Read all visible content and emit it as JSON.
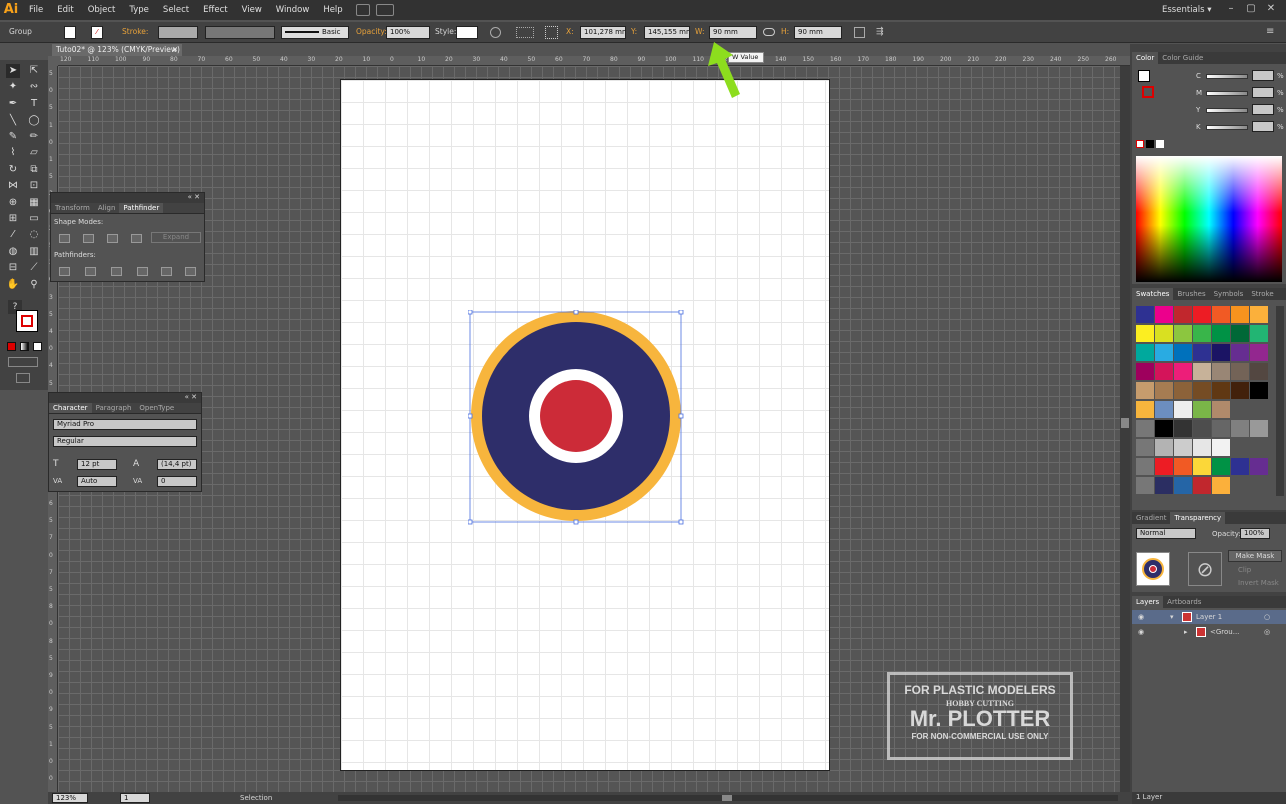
{
  "app": {
    "logo": "Ai",
    "menus": [
      "File",
      "Edit",
      "Object",
      "Type",
      "Select",
      "Effect",
      "View",
      "Window",
      "Help"
    ],
    "workspace": "Essentials ▾",
    "window_controls": [
      "–",
      "▢",
      "✕"
    ]
  },
  "control": {
    "selection": "Group",
    "stroke_label": "Stroke:",
    "brush_label": "Basic",
    "opacity_label": "Opacity:",
    "opacity": "100%",
    "style_label": "Style:",
    "x_label": "X:",
    "x": "101,278 mm",
    "y_label": "Y:",
    "y": "145,155 mm",
    "w_label": "W:",
    "w": "90 mm",
    "h_label": "H:",
    "h": "90 mm"
  },
  "tooltip": "W Value",
  "document": {
    "tab": "Tuto02* @ 123% (CMYK/Preview)",
    "close": "✕"
  },
  "ruler_h": [
    "120",
    "110",
    "100",
    "90",
    "80",
    "70",
    "60",
    "50",
    "40",
    "30",
    "20",
    "10",
    "0",
    "10",
    "20",
    "30",
    "40",
    "50",
    "60",
    "70",
    "80",
    "90",
    "100",
    "110",
    "120",
    "130",
    "140",
    "150",
    "160",
    "170",
    "180",
    "190",
    "200",
    "210",
    "220",
    "230",
    "240",
    "250",
    "260",
    "270",
    "280",
    "290",
    "300",
    "310",
    "320",
    "330",
    "340"
  ],
  "ruler_v": [
    "5",
    "0",
    "5",
    "1",
    "0",
    "1",
    "5",
    "2",
    "0",
    "2",
    "5",
    "3",
    "0",
    "3",
    "5",
    "4",
    "0",
    "4",
    "5",
    "5",
    "0",
    "5",
    "5",
    "6",
    "0",
    "6",
    "5",
    "7",
    "0",
    "7",
    "5",
    "8",
    "0",
    "8",
    "5",
    "9",
    "0",
    "9",
    "5",
    "1",
    "0",
    "0"
  ],
  "pathfinder": {
    "tabs": [
      "Transform",
      "Align",
      "Pathfinder"
    ],
    "shape_modes": "Shape Modes:",
    "expand": "Expand",
    "pathfinders": "Pathfinders:"
  },
  "character": {
    "tabs": [
      "Character",
      "Paragraph",
      "OpenType"
    ],
    "font": "Myriad Pro",
    "style": "Regular",
    "size": "12 pt",
    "leading": "(14,4 pt)",
    "kerning": "Auto",
    "tracking": "0"
  },
  "color_panel": {
    "tabs": [
      "Color",
      "Color Guide"
    ],
    "channels": [
      "C",
      "M",
      "Y",
      "K"
    ],
    "pct": "%"
  },
  "swatches": {
    "tabs": [
      "Swatches",
      "Brushes",
      "Symbols",
      "Stroke"
    ],
    "colors": [
      "#2e3192",
      "#ec008c",
      "#c1272d",
      "#ed1c24",
      "#f15a24",
      "#f7931e",
      "#fbb03b",
      "#fcee21",
      "#d9e021",
      "#8cc63f",
      "#39b54a",
      "#009245",
      "#006837",
      "#22b573",
      "#00a99d",
      "#29abe2",
      "#0071bc",
      "#2e3192",
      "#1b1464",
      "#662d91",
      "#93278f",
      "#9e005d",
      "#d4145a",
      "#ed1e79",
      "#c7b299",
      "#998675",
      "#736357",
      "#534741",
      "#c69c6d",
      "#a67c52",
      "#8c6239",
      "#754c24",
      "#603813",
      "#42210b",
      "#000000",
      "#888888"
    ],
    "grays": [
      "#000000",
      "#333333",
      "#4d4d4d",
      "#666666",
      "#808080",
      "#999999",
      "#b3b3b3",
      "#cccccc",
      "#e6e6e6",
      "#f2f2f2"
    ],
    "group": [
      "#ed1c24",
      "#f15a24",
      "#fbd739",
      "#009245",
      "#2e3192",
      "#662d91",
      "#2b2e62",
      "#2565a6",
      "#c1272d",
      "#fbb03b"
    ]
  },
  "transparency": {
    "tabs": [
      "Gradient",
      "Transparency"
    ],
    "mode": "Normal",
    "opacity_label": "Opacity:",
    "opacity": "100%",
    "make_mask": "Make Mask",
    "clip": "Clip",
    "invert": "Invert Mask"
  },
  "layers": {
    "tabs": [
      "Layers",
      "Artboards"
    ],
    "rows": [
      "Layer 1",
      "<Grou..."
    ],
    "count": "1 Layer"
  },
  "status": {
    "zoom": "123%",
    "page": "1",
    "tool": "Selection"
  },
  "roundel": {
    "outer": "#f7b53d",
    "blue": "#2e2e6a",
    "white": "#ffffff",
    "red": "#cc2b38"
  },
  "watermark": {
    "line1": "FOR PLASTIC MODELERS",
    "line2": "HOBBY CUTTING",
    "line3": "Mr. PLOTTER",
    "line4": "FOR NON-COMMERCIAL USE ONLY"
  }
}
